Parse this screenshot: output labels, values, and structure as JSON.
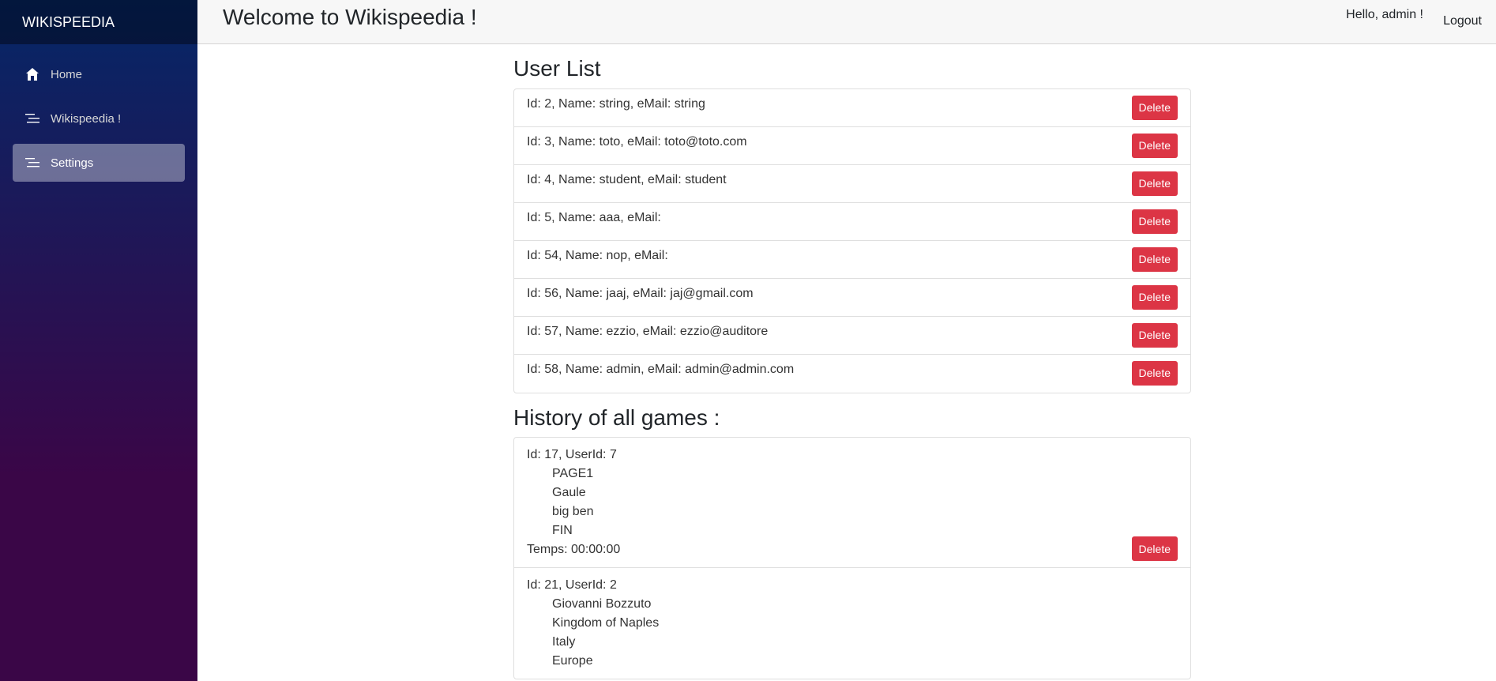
{
  "sidebar": {
    "brand": "WIKISPEEDIA",
    "items": [
      {
        "label": "Home",
        "icon": "home-icon"
      },
      {
        "label": "Wikispeedia !",
        "icon": "list-icon"
      },
      {
        "label": "Settings",
        "icon": "list-icon",
        "active": true
      }
    ]
  },
  "header": {
    "welcome": "Welcome to Wikispeedia !",
    "greeting": "Hello, admin !",
    "logout": "Logout"
  },
  "users": {
    "title": "User List",
    "delete_label": "Delete",
    "rows": [
      "Id: 2, Name: string, eMail: string",
      "Id: 3, Name: toto, eMail: toto@toto.com",
      "Id: 4, Name: student, eMail: student",
      "Id: 5, Name: aaa, eMail:",
      "Id: 54, Name: nop, eMail:",
      "Id: 56, Name: jaaj, eMail: jaj@gmail.com",
      "Id: 57, Name: ezzio, eMail: ezzio@auditore",
      "Id: 58, Name: admin, eMail: admin@admin.com"
    ]
  },
  "history": {
    "title": "History of all games :",
    "delete_label": "Delete",
    "games": [
      {
        "header": "Id: 17, UserId: 7",
        "pages": [
          "PAGE1",
          "Gaule",
          "big ben",
          "FIN"
        ],
        "time": "Temps: 00:00:00"
      },
      {
        "header": "Id: 21, UserId: 2",
        "pages": [
          "Giovanni Bozzuto",
          "Kingdom of Naples",
          "Italy",
          "Europe"
        ],
        "time": ""
      }
    ]
  },
  "colors": {
    "danger": "#dc3545",
    "sidebar_top": "#052767",
    "sidebar_bottom": "#3a0647"
  }
}
